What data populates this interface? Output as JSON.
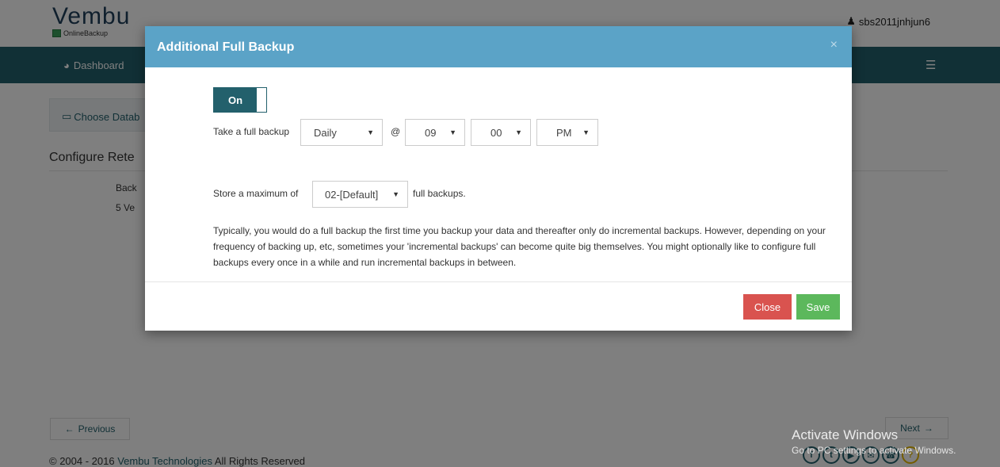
{
  "background": {
    "logo": {
      "word": "Vembu",
      "sub": "OnlineBackup"
    },
    "user": "sbs2011jnhjun6",
    "nav": {
      "dashboard": "Dashboard"
    },
    "choose_label": "Choose Datab",
    "configure_title": "Configure Rete",
    "row1": "Back",
    "row2": "5 Ve",
    "prev_label": "Previous",
    "next_label": "Next",
    "footer": {
      "copyright": "© 2004 - 2016 ",
      "company": "Vembu Technologies",
      "rights": " All Rights Reserved"
    },
    "activate": {
      "title": "Activate Windows",
      "sub": "Go to PC settings to activate Windows."
    }
  },
  "modal": {
    "title": "Additional Full Backup",
    "close_x": "×",
    "toggle_label": "On",
    "take_label": "Take a full backup",
    "frequency": "Daily",
    "at": "@",
    "hour": "09",
    "minute": "00",
    "ampm": "PM",
    "store_label": "Store a maximum of",
    "max_backups": "02-[Default]",
    "full_backups_label": "full backups.",
    "description": "Typically, you would do a full backup the first time you backup your data and thereafter only do incremental backups. However, depending on your frequency of backing up, etc, sometimes your 'incremental backups' can become quite big themselves. You might optionally like to configure full backups every once in a while and run incremental backups in between.",
    "close_button": "Close",
    "save_button": "Save"
  }
}
